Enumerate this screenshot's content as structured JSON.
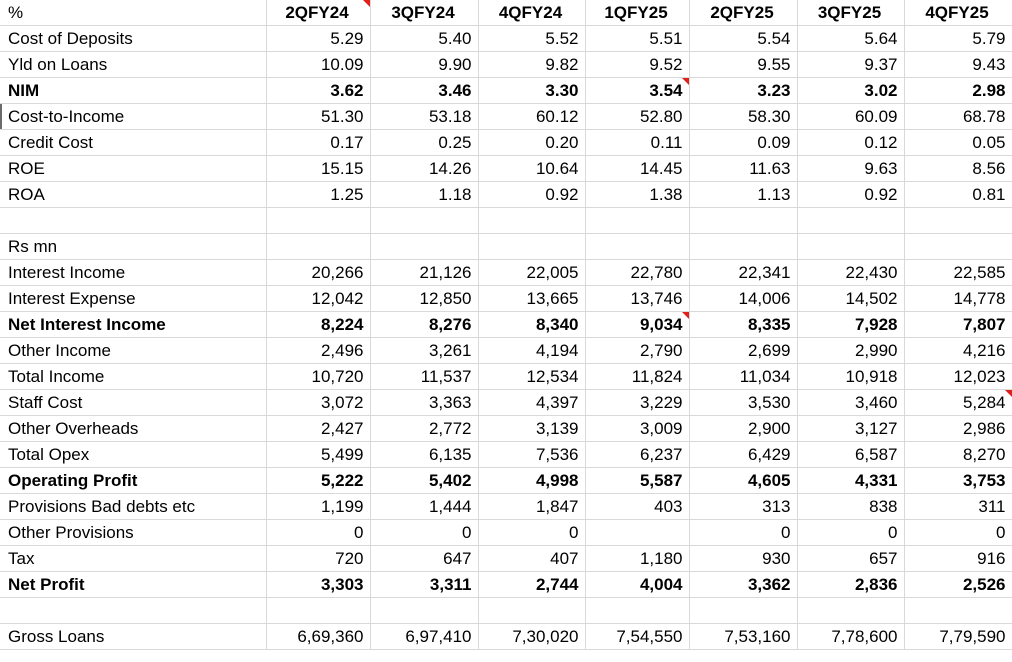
{
  "columns": [
    "2QFY24",
    "3QFY24",
    "4QFY24",
    "1QFY25",
    "2QFY25",
    "3QFY25",
    "4QFY25"
  ],
  "ratio_section": {
    "unit_label": "%",
    "rows": [
      {
        "label": "Cost of Deposits",
        "values": [
          "5.29",
          "5.40",
          "5.52",
          "5.51",
          "5.54",
          "5.64",
          "5.79"
        ],
        "bold": false
      },
      {
        "label": "Yld on Loans",
        "values": [
          "10.09",
          "9.90",
          "9.82",
          "9.52",
          "9.55",
          "9.37",
          "9.43"
        ],
        "bold": false
      },
      {
        "label": "NIM",
        "values": [
          "3.62",
          "3.46",
          "3.30",
          "3.54",
          "3.23",
          "3.02",
          "2.98"
        ],
        "bold": true
      },
      {
        "label": "Cost-to-Income",
        "values": [
          "51.30",
          "53.18",
          "60.12",
          "52.80",
          "58.30",
          "60.09",
          "68.78"
        ],
        "bold": false
      },
      {
        "label": "Credit Cost",
        "values": [
          "0.17",
          "0.25",
          "0.20",
          "0.11",
          "0.09",
          "0.12",
          "0.05"
        ],
        "bold": false
      },
      {
        "label": "ROE",
        "values": [
          "15.15",
          "14.26",
          "10.64",
          "14.45",
          "11.63",
          "9.63",
          "8.56"
        ],
        "bold": false
      },
      {
        "label": "ROA",
        "values": [
          "1.25",
          "1.18",
          "0.92",
          "1.38",
          "1.13",
          "0.92",
          "0.81"
        ],
        "bold": false
      }
    ]
  },
  "amount_section": {
    "unit_label": "Rs mn",
    "rows": [
      {
        "label": "Interest Income",
        "values": [
          "20,266",
          "21,126",
          "22,005",
          "22,780",
          "22,341",
          "22,430",
          "22,585"
        ],
        "bold": false
      },
      {
        "label": "Interest Expense",
        "values": [
          "12,042",
          "12,850",
          "13,665",
          "13,746",
          "14,006",
          "14,502",
          "14,778"
        ],
        "bold": false
      },
      {
        "label": "Net Interest Income",
        "values": [
          "8,224",
          "8,276",
          "8,340",
          "9,034",
          "8,335",
          "7,928",
          "7,807"
        ],
        "bold": true
      },
      {
        "label": "Other Income",
        "values": [
          "2,496",
          "3,261",
          "4,194",
          "2,790",
          "2,699",
          "2,990",
          "4,216"
        ],
        "bold": false
      },
      {
        "label": "Total Income",
        "values": [
          "10,720",
          "11,537",
          "12,534",
          "11,824",
          "11,034",
          "10,918",
          "12,023"
        ],
        "bold": false
      },
      {
        "label": "Staff Cost",
        "values": [
          "3,072",
          "3,363",
          "4,397",
          "3,229",
          "3,530",
          "3,460",
          "5,284"
        ],
        "bold": false
      },
      {
        "label": "Other Overheads",
        "values": [
          "2,427",
          "2,772",
          "3,139",
          "3,009",
          "2,900",
          "3,127",
          "2,986"
        ],
        "bold": false
      },
      {
        "label": "Total Opex",
        "values": [
          "5,499",
          "6,135",
          "7,536",
          "6,237",
          "6,429",
          "6,587",
          "8,270"
        ],
        "bold": false
      },
      {
        "label": "Operating Profit",
        "values": [
          "5,222",
          "5,402",
          "4,998",
          "5,587",
          "4,605",
          "4,331",
          "3,753"
        ],
        "bold": true
      },
      {
        "label": "Provisions Bad debts etc",
        "values": [
          "1,199",
          "1,444",
          "1,847",
          "403",
          "313",
          "838",
          "311"
        ],
        "bold": false
      },
      {
        "label": "Other Provisions",
        "values": [
          "0",
          "0",
          "0",
          "",
          "0",
          "0",
          "0"
        ],
        "bold": false
      },
      {
        "label": "Tax",
        "values": [
          "720",
          "647",
          "407",
          "1,180",
          "930",
          "657",
          "916"
        ],
        "bold": false
      },
      {
        "label": "Net Profit",
        "values": [
          "3,303",
          "3,311",
          "2,744",
          "4,004",
          "3,362",
          "2,836",
          "2,526"
        ],
        "bold": true
      }
    ]
  },
  "gross_loans": {
    "label": "Gross Loans",
    "values": [
      "6,69,360",
      "6,97,410",
      "7,30,020",
      "7,54,550",
      "7,53,160",
      "7,78,600",
      "7,79,590"
    ]
  },
  "comment_color": "#e0201b",
  "gridline_color": "#d9d9d9"
}
